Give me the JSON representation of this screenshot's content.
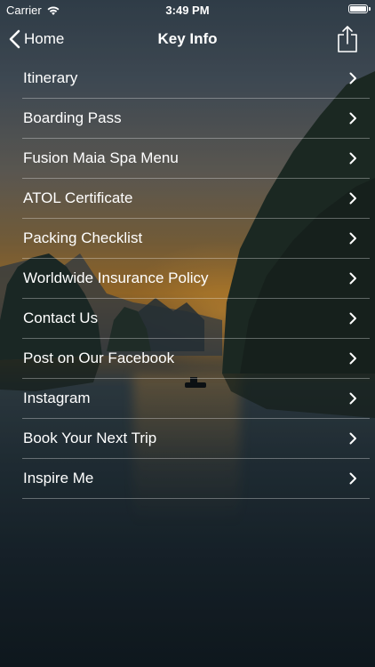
{
  "status_bar": {
    "carrier": "Carrier",
    "time": "3:49 PM",
    "wifi_icon": "wifi-icon",
    "battery_icon": "battery-icon",
    "battery_level": 1.0
  },
  "nav": {
    "back_label": "Home",
    "title": "Key Info",
    "back_icon": "chevron-left-icon",
    "share_icon": "share-icon"
  },
  "menu": {
    "items": [
      {
        "label": "Itinerary"
      },
      {
        "label": "Boarding Pass"
      },
      {
        "label": "Fusion Maia Spa Menu"
      },
      {
        "label": "ATOL Certificate"
      },
      {
        "label": "Packing Checklist"
      },
      {
        "label": "Worldwide Insurance Policy"
      },
      {
        "label": "Contact Us"
      },
      {
        "label": "Post on Our Facebook"
      },
      {
        "label": "Instagram"
      },
      {
        "label": "Book Your Next Trip"
      },
      {
        "label": "Inspire Me"
      }
    ],
    "chevron_icon": "chevron-right-icon"
  },
  "colors": {
    "text": "#ffffff",
    "separator": "rgba(255,255,255,0.32)"
  }
}
